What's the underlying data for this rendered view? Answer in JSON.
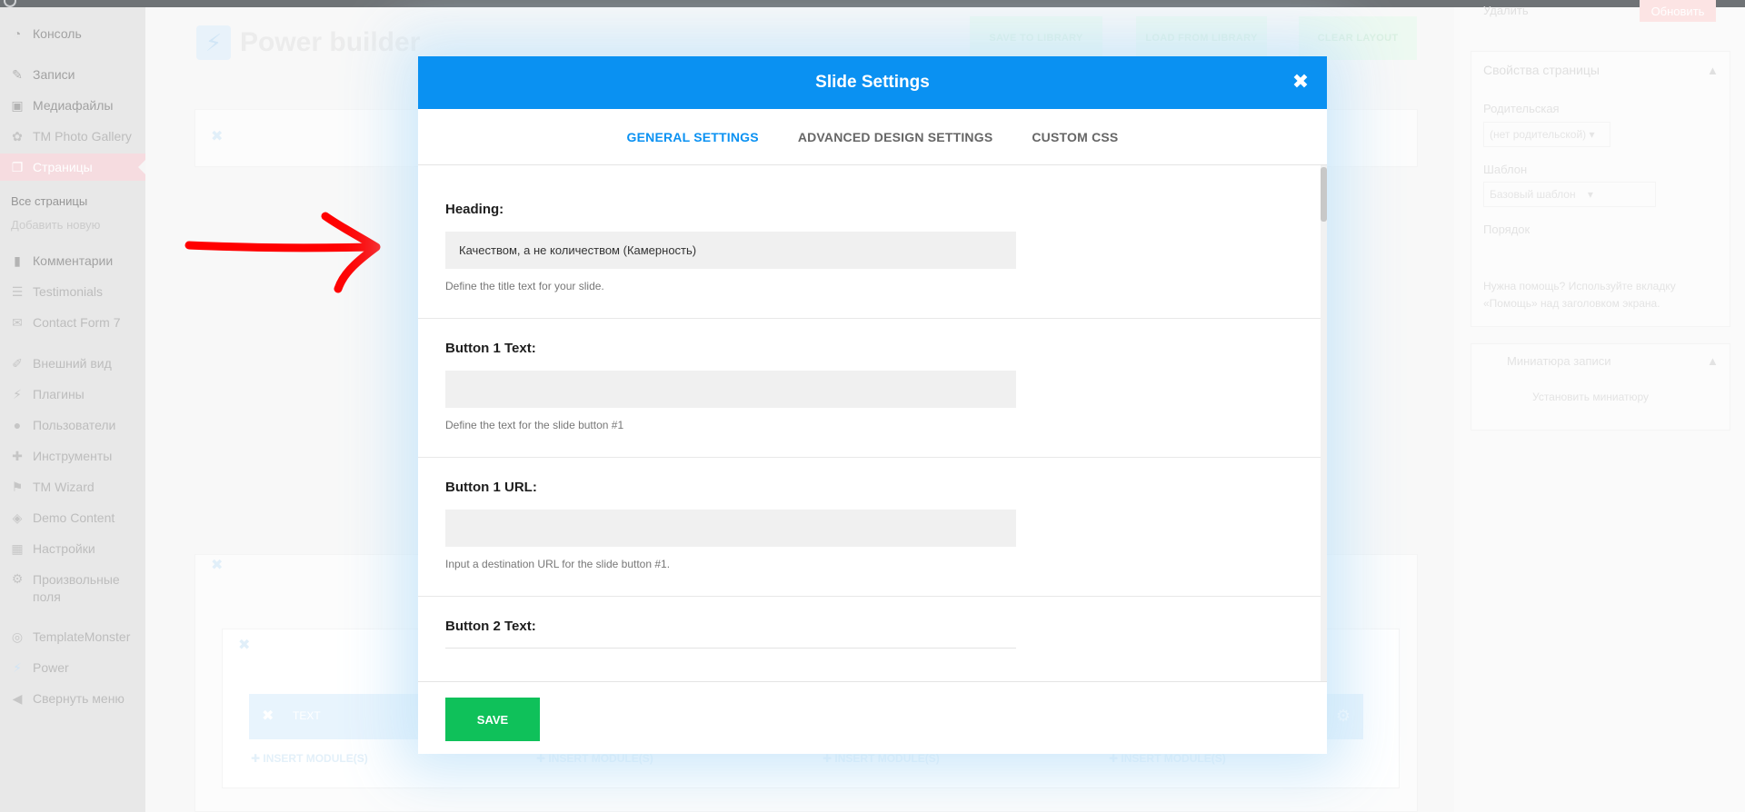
{
  "admin_menu": {
    "items": [
      {
        "label": "Консоль",
        "icon": "dashboard-icon"
      },
      {
        "label": "Записи",
        "icon": "pin-icon"
      },
      {
        "label": "Медиафайлы",
        "icon": "media-icon"
      },
      {
        "label": "TM Photo Gallery",
        "icon": "gallery-icon"
      },
      {
        "label": "Страницы",
        "icon": "pages-icon"
      },
      {
        "label": "Комментарии",
        "icon": "comment-icon"
      },
      {
        "label": "Testimonials",
        "icon": "testimonial-icon"
      },
      {
        "label": "Contact Form 7",
        "icon": "mail-icon"
      },
      {
        "label": "Внешний вид",
        "icon": "brush-icon"
      },
      {
        "label": "Плагины",
        "icon": "plugin-icon"
      },
      {
        "label": "Пользователи",
        "icon": "user-icon"
      },
      {
        "label": "Инструменты",
        "icon": "wrench-icon"
      },
      {
        "label": "TM Wizard",
        "icon": "flag-icon"
      },
      {
        "label": "Demo Content",
        "icon": "database-icon"
      },
      {
        "label": "Настройки",
        "icon": "settings-icon"
      },
      {
        "label": "Произвольные поля",
        "icon": "gear-icon"
      },
      {
        "label": "TemplateMonster",
        "icon": "monster-icon"
      },
      {
        "label": "Power",
        "icon": "power-icon"
      },
      {
        "label": "Свернуть меню",
        "icon": "collapse-icon"
      }
    ],
    "submenu": [
      "Все страницы",
      "Добавить новую"
    ]
  },
  "builder": {
    "title": "Power builder",
    "buttons": [
      "SAVE TO LIBRARY",
      "LOAD FROM LIBRARY",
      "CLEAR LAYOUT"
    ],
    "module_label": "TEXT",
    "insert_label": "INSERT MODULE(S)"
  },
  "right_panel": {
    "delete_link": "Удалить",
    "update_button": "Обновить",
    "page_props_title": "Свойства страницы",
    "parent_label": "Родительская",
    "parent_value": "(нет родительской)",
    "template_label": "Шаблон",
    "template_value": "Базовый шаблон",
    "order_label": "Порядок",
    "help_line_1": "Нужна помощь? Используйте вкладку",
    "help_line_2": "«Помощь» над заголовком экрана.",
    "featured_title": "Миниатюра записи",
    "featured_link": "Установить миниатюру"
  },
  "modal": {
    "title": "Slide Settings",
    "tabs": [
      "GENERAL SETTINGS",
      "ADVANCED DESIGN SETTINGS",
      "CUSTOM CSS"
    ],
    "fields": [
      {
        "label": "Heading:",
        "value": "Качеством, а не количеством (Камерность)",
        "desc": "Define the title text for your slide."
      },
      {
        "label": "Button 1 Text:",
        "value": "",
        "desc": "Define the text for the slide button #1"
      },
      {
        "label": "Button 1 URL:",
        "value": "",
        "desc": "Input a destination URL for the slide button #1."
      },
      {
        "label": "Button 2 Text:"
      }
    ],
    "save_label": "SAVE"
  },
  "colors": {
    "header_blue": "#0a91f2",
    "save_green": "#0fc15a",
    "annotation_red": "#ff0000"
  }
}
